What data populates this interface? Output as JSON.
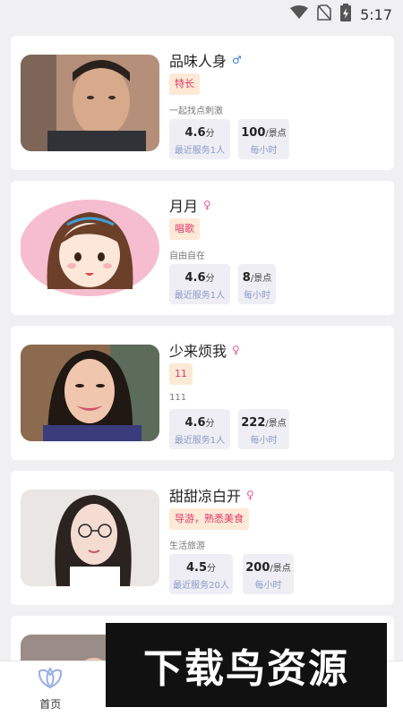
{
  "status_bar": {
    "time": "5:17",
    "icons": [
      "wifi-icon",
      "no-sim-icon",
      "battery-charging-icon"
    ]
  },
  "cards": [
    {
      "name": "品味人身",
      "gender": "male",
      "gender_symbol": "♂",
      "tag": "特长",
      "bio": "一起找点刺激",
      "rating": "4.6",
      "rating_unit": "分",
      "served": "最近服务1人",
      "price": "100",
      "price_unit": "/景点",
      "per": "每小时"
    },
    {
      "name": "月月",
      "gender": "female",
      "gender_symbol": "♀",
      "tag": "唱歌",
      "bio": "自由自在",
      "rating": "4.6",
      "rating_unit": "分",
      "served": "最近服务1人",
      "price": "8",
      "price_unit": "/景点",
      "per": "每小时"
    },
    {
      "name": "少来烦我",
      "gender": "female",
      "gender_symbol": "♀",
      "tag": "11",
      "bio": "111",
      "rating": "4.6",
      "rating_unit": "分",
      "served": "最近服务1人",
      "price": "222",
      "price_unit": "/景点",
      "per": "每小时"
    },
    {
      "name": "甜甜凉白开",
      "gender": "female",
      "gender_symbol": "♀",
      "tag": "导游，熟悉美食",
      "bio": "生活旅游",
      "rating": "4.5",
      "rating_unit": "分",
      "served": "最近服务20人",
      "price": "200",
      "price_unit": "/景点",
      "per": "每小时"
    }
  ],
  "nav": {
    "home_label": "首页"
  },
  "watermark": "下载鸟资源",
  "colors": {
    "tag_bg": "#fde9d6",
    "tag_text": "#e0386b",
    "stat_bg": "#eeeef4",
    "male": "#2f7fd6",
    "female": "#e35d9b"
  }
}
